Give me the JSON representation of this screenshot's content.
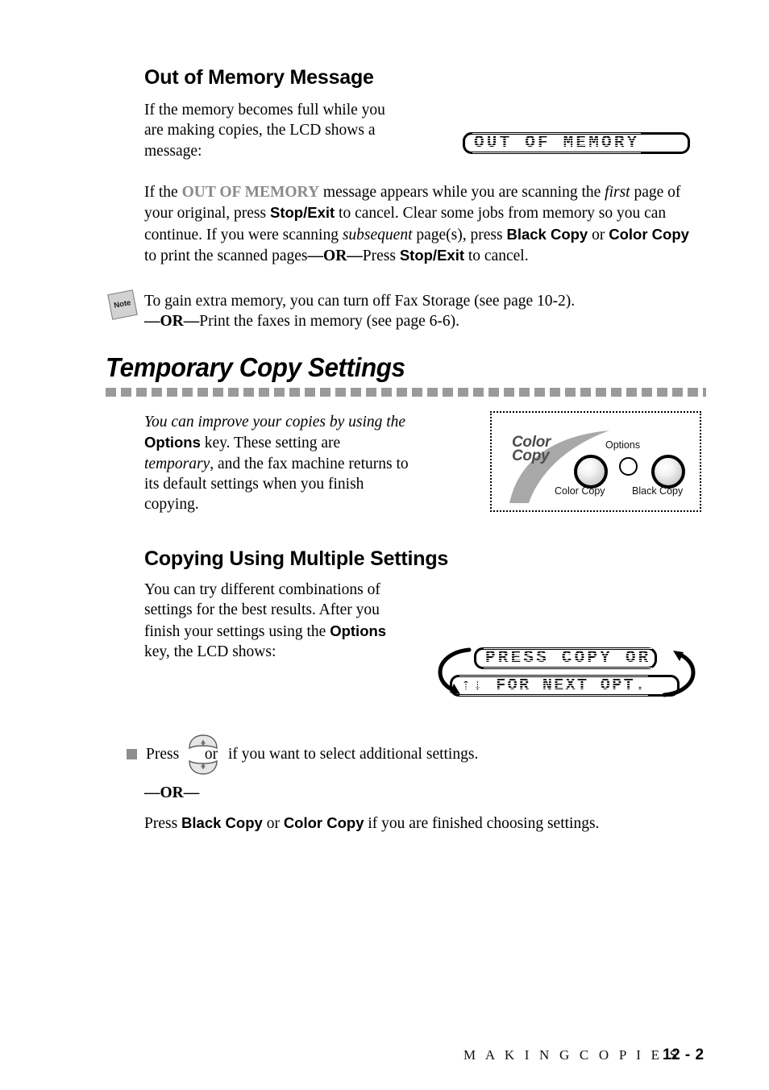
{
  "document": {
    "page_label": "12 - 2",
    "footer_title": "M A K I N G   C O P I E S"
  },
  "section_out_of_memory": {
    "heading": "Out of Memory Message",
    "intro_paragraph": "If the memory becomes full while you are making copies, the LCD shows a message:",
    "lcd_message": "OUT OF MEMORY",
    "body": {
      "part1": "If the ",
      "emph_message": "OUT OF MEMORY",
      "part2": " message appears while you are scanning the ",
      "italic1": "first",
      "part3": " page of your original, press ",
      "key1": "Stop/Exit",
      "part4": " to cancel. Clear some jobs from memory so you can continue. If you were scanning ",
      "italic2": "subsequent",
      "part5": " page(s), press ",
      "key2": "Black Copy",
      "part6": " or ",
      "key3": "Color Copy",
      "part7": " to print the scanned pages",
      "or": "—OR—",
      "part8": "Press ",
      "key4": "Stop/Exit",
      "part9": " to cancel."
    }
  },
  "note": {
    "icon_label": "Note",
    "line1": "To gain extra memory, you can turn off Fax Storage (see page 10-2).",
    "or": "—OR—",
    "line2": "Print the faxes in memory (see page 6-6)."
  },
  "section_temporary": {
    "heading": "Temporary Copy Settings",
    "body": {
      "italic_lead": "You can improve your copies by using the",
      "key1": "Options",
      "part1": " key. These setting are ",
      "italic1": "temporary",
      "part2": ", and the fax machine returns to its default settings when you finish copying."
    }
  },
  "control_panel": {
    "logo_line1": "Color",
    "logo_line2": "Copy",
    "options_label": "Options",
    "color_copy_label": "Color Copy",
    "black_copy_label": "Black Copy"
  },
  "section_multiple": {
    "heading": "Copying Using Multiple Settings",
    "body": {
      "part1": "You can try different combinations of settings for the best results. After you finish your settings using the ",
      "key1": "Options",
      "part2": " key, the LCD shows:"
    },
    "lcd_line1": "PRESS COPY OR",
    "lcd_line2": "↑↓ FOR NEXT OPT.",
    "step": {
      "press": "Press",
      "key_glyph_text": "or",
      "after": "if you want to select additional settings."
    },
    "or": "—OR—",
    "final": {
      "part1": "Press ",
      "key1": "Black Copy",
      "part2": " or ",
      "key2": "Color Copy",
      "part3": " if you are finished choosing settings."
    }
  },
  "colors": {
    "gray_emphasis": "#8a8a8a",
    "rule_gray": "#9a9a9a",
    "bullet_gray": "#8e8e8e",
    "logo_gray": "#4d4d4d"
  }
}
